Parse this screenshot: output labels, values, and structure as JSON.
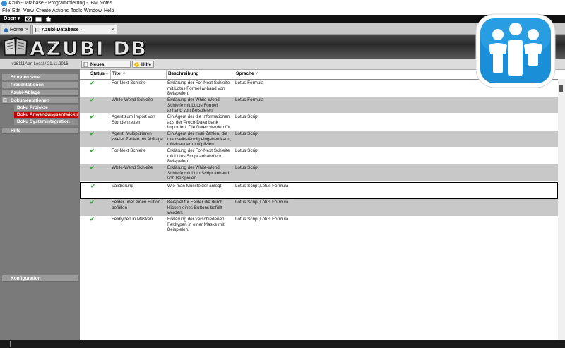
{
  "window": {
    "title": "Azubi-Database - Programmierung - IBM Notes"
  },
  "menu": [
    "File",
    "Edit",
    "View",
    "Create",
    "Actions",
    "Tools",
    "Window",
    "Help"
  ],
  "toolbar": {
    "open_label": "Open ▾"
  },
  "tabs": [
    {
      "label": "Home",
      "close": "×"
    },
    {
      "label": "Azubi-Database - Programmierung",
      "close": "×"
    }
  ],
  "banner": {
    "logo_text": "AZUBI DB"
  },
  "nav": {
    "version": "v16111Aon Local / 21.11.2016",
    "items": [
      "Stundenzettel",
      "Präsentationen",
      "Azubi-Ablage",
      "Dokumentationen",
      "Hilfe"
    ],
    "expander": "⊟",
    "subitems": [
      "Doku Projekte",
      "Doku Anwendungsentwicklung",
      "Doku Systemintegration"
    ],
    "footer": "Konfiguration"
  },
  "actions": {
    "new_doc": "Neues Dokument",
    "help": "Hilfe"
  },
  "columns": [
    {
      "label": "Status",
      "sort": "˄"
    },
    {
      "label": "Titel",
      "sort": "˄"
    },
    {
      "label": "Beschreibung",
      "sort": ""
    },
    {
      "label": "Sprache",
      "sort": "˅"
    }
  ],
  "rows": [
    {
      "status": "✔",
      "title": "For-Next Schleife",
      "desc": "Erklärung der For-Next Schleife mit Lotus Formel anhand von Beispielen.",
      "lang": "Lotus Formula"
    },
    {
      "status": "✔",
      "title": "While-Wend Schleife",
      "desc": "Erklärung der While-Wend Schleife mit Lotus Formel anhand von Beispielen.",
      "lang": "Lotus Formula"
    },
    {
      "status": "✔",
      "title": "Agent zum Import von Stundenzetteln",
      "desc": "Ein Agent der die Informationen aus der Proco-Datenbank importiert. Die Daten werden für",
      "lang": "Lotus Script"
    },
    {
      "status": "✔",
      "title": "Agent: Multiplizieren zweier Zahlen mit Abfrage",
      "desc": "Ein Agent der zwei Zahlen, die man selbständig eingeben kann, miteinander multipliziert.",
      "lang": "Lotus Script"
    },
    {
      "status": "✔",
      "title": "For-Next Schleife",
      "desc": "Erklärung der For-Next Schleife mit Lotus Script anhand von Beispielen.",
      "lang": "Lotus Script"
    },
    {
      "status": "✔",
      "title": "While-Wend Schleife",
      "desc": "Erklärung der While-Wend Schleife mit Lotu Script anhand von Beispielen.",
      "lang": "Lotus Script"
    },
    {
      "status": "✔",
      "title": "Validierung",
      "desc": "Wie man Mussfelder anlegt.",
      "lang": "Lotus Script,Lotus Formula"
    },
    {
      "status": "✔",
      "title": "Felder über einen Button befüllen",
      "desc": "Beispiel für Felder die durch klicken eines Buttons befüllt werden.",
      "lang": "Lotus Script,Lotus Formula"
    },
    {
      "status": "✔",
      "title": "Feldtypen in Masken",
      "desc": "Erklärung der verschiedenen Feldtypen in einer Maske mit Beispielen.",
      "lang": "Lotus Script,Lotus Formula"
    }
  ],
  "colors": {
    "accent_red": "#c40000",
    "check_green": "#3aa93a",
    "logo_blue": "#1a8fd8"
  }
}
